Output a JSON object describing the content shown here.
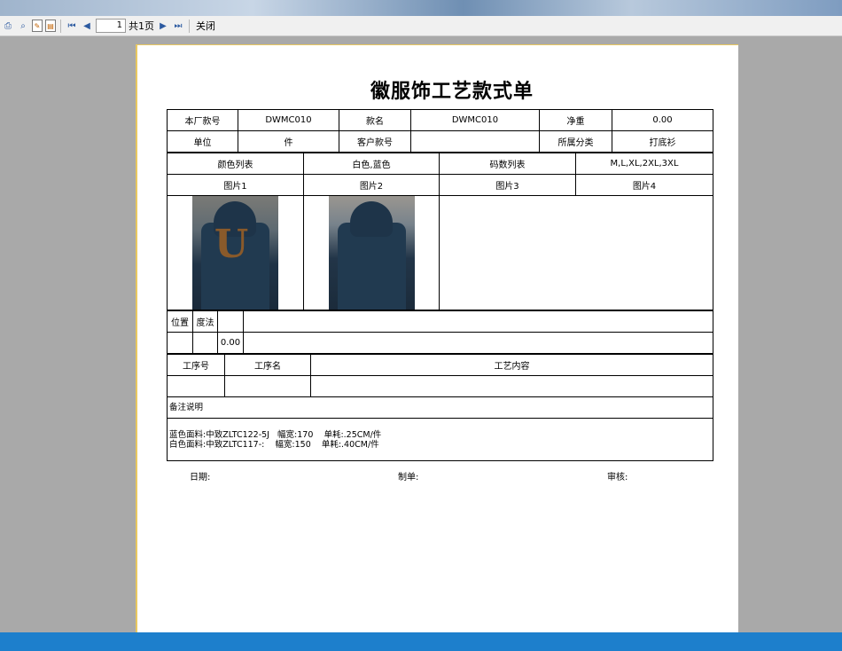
{
  "toolbar": {
    "page_value": "1",
    "page_total": "共1页",
    "close_label": "关闭"
  },
  "doc": {
    "title": "徽服饰工艺款式单",
    "row1": {
      "factory_no_label": "本厂款号",
      "factory_no": "DWMC010",
      "style_name_label": "款名",
      "style_name": "DWMC010",
      "net_weight_label": "净重",
      "net_weight": "0.00"
    },
    "row2": {
      "unit_label": "单位",
      "unit": "件",
      "customer_no_label": "客户款号",
      "customer_no": "",
      "category_label": "所属分类",
      "category": "打底衫"
    },
    "row3": {
      "color_list_label": "颜色列表",
      "colors": "白色,蓝色",
      "size_list_label": "码数列表",
      "sizes": "M,L,XL,2XL,3XL"
    },
    "pictures": {
      "pic1_label": "图片1",
      "pic2_label": "图片2",
      "pic3_label": "图片3",
      "pic4_label": "图片4"
    },
    "measure": {
      "position_label": "位置",
      "method_label": "度法",
      "value": "0.00"
    },
    "process": {
      "no_label": "工序号",
      "name_label": "工序名",
      "content_label": "工艺内容"
    },
    "remark_label": "备注说明",
    "remark_lines": [
      "蓝色面料:中致ZLTC122-5J   幅宽:170    单耗:.25CM/件",
      "白色面料:中致ZLTC117-:    幅宽:150    单耗:.40CM/件"
    ],
    "footer": {
      "date_label": "日期:",
      "maker_label": "制单:",
      "review_label": "审核:"
    }
  },
  "colors": {
    "taskbar": "#1d7fcc",
    "background": "#a9a9a9",
    "paper_border": "#e8c860"
  }
}
